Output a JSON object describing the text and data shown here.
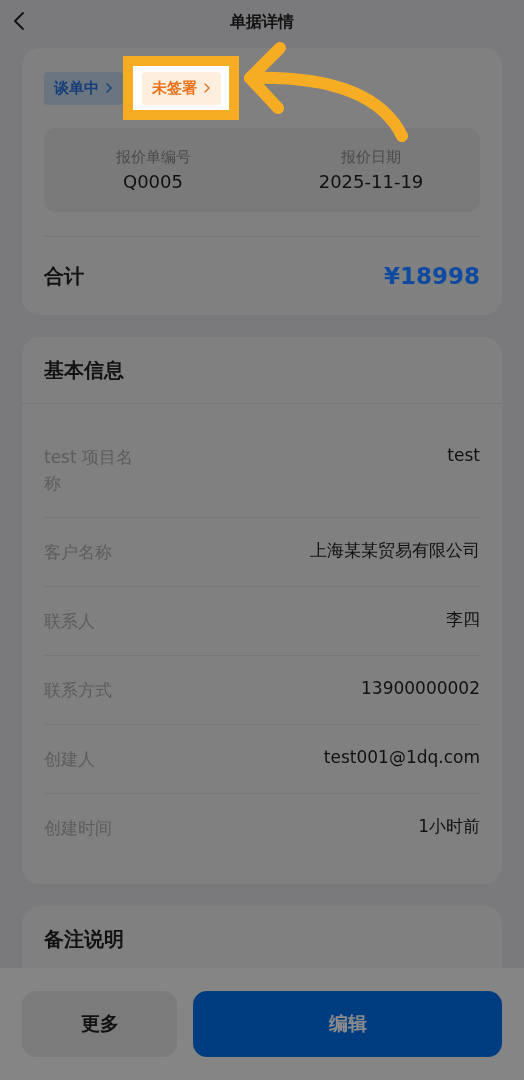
{
  "header": {
    "title": "单据详情"
  },
  "summary": {
    "tags": [
      {
        "label": "谈单中",
        "highlighted": false
      },
      {
        "label": "未签署",
        "highlighted": true
      }
    ],
    "fields": [
      {
        "label": "报价单编号",
        "value": "Q0005"
      },
      {
        "label": "报价日期",
        "value": "2025-11-19"
      }
    ],
    "total": {
      "label": "合计",
      "value": "¥18998"
    }
  },
  "basic_info": {
    "title": "基本信息",
    "rows": [
      {
        "label": "test 项目名称",
        "value": "test"
      },
      {
        "label": "客户名称",
        "value": "上海某某贸易有限公司"
      },
      {
        "label": "联系人",
        "value": "李四"
      },
      {
        "label": "联系方式",
        "value": "13900000002"
      },
      {
        "label": "创建人",
        "value": "test001@1dq.com"
      },
      {
        "label": "创建时间",
        "value": "1小时前"
      }
    ]
  },
  "notes": {
    "title": "备注说明"
  },
  "actions": [
    {
      "label": "更多",
      "kind": "secondary"
    },
    {
      "label": "编辑",
      "kind": "primary"
    }
  ]
}
